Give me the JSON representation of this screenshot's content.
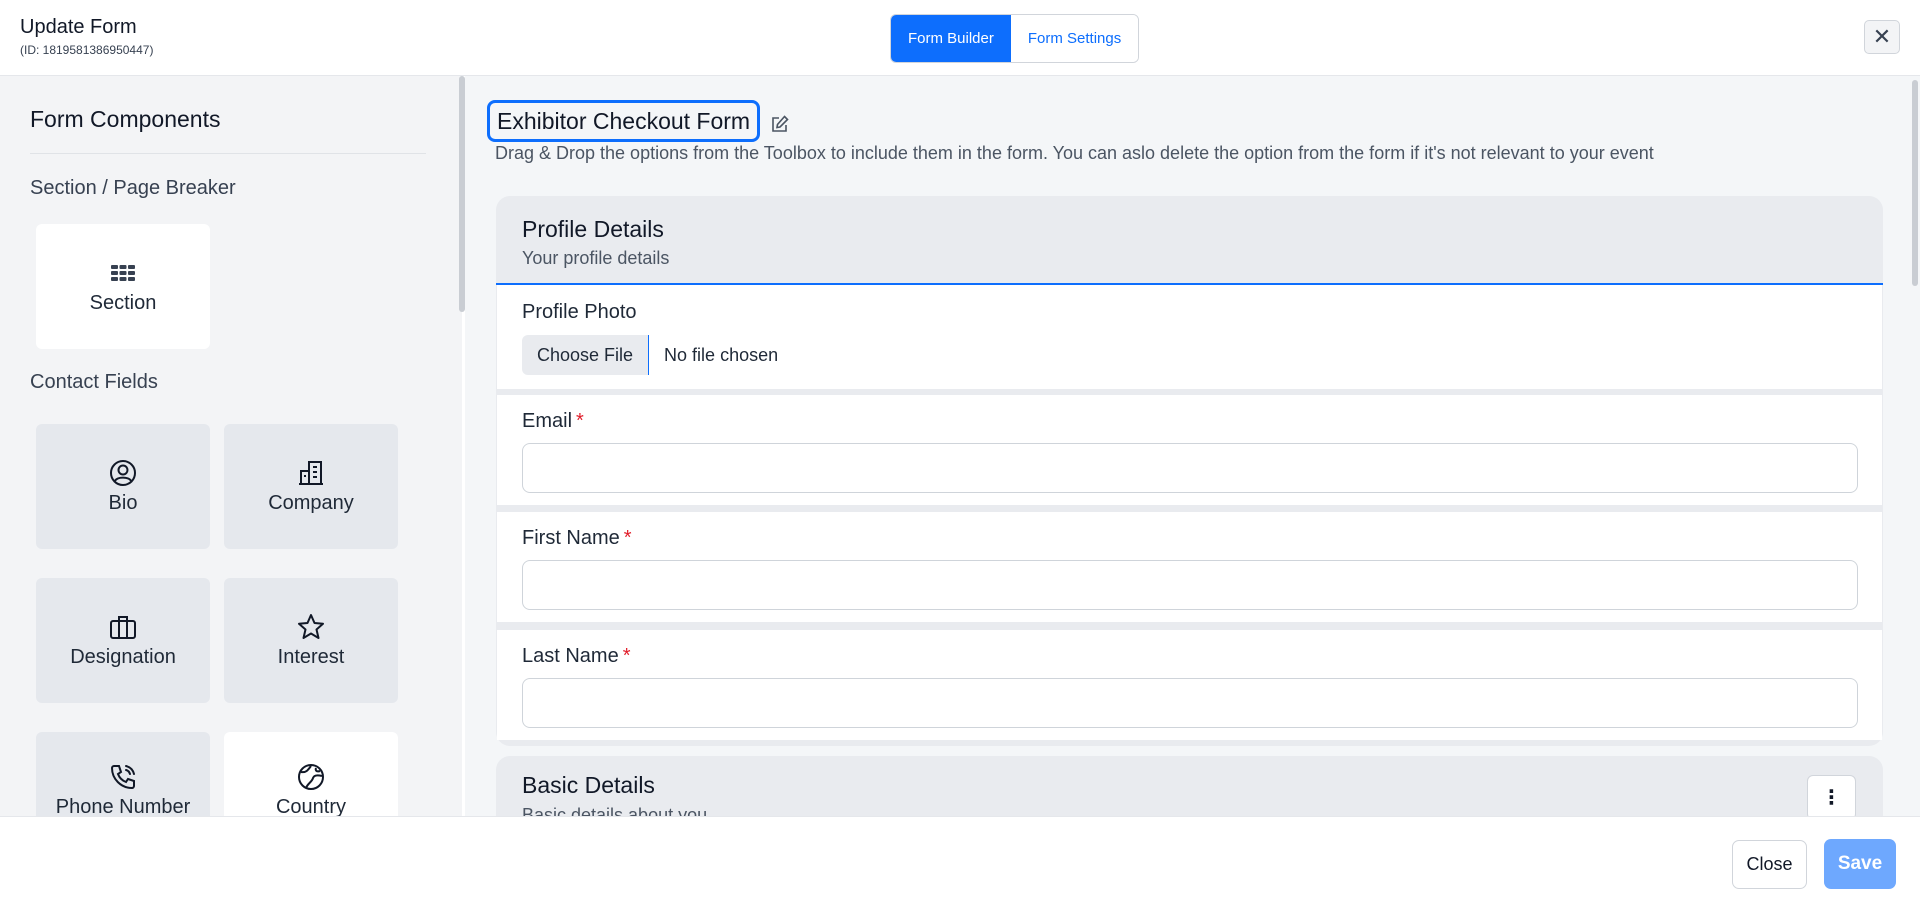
{
  "header": {
    "title": "Update Form",
    "form_id": "(ID: 1819581386950447)",
    "tabs": [
      {
        "label": "Form Builder",
        "active": true
      },
      {
        "label": "Form Settings",
        "active": false
      }
    ],
    "close_symbol": "✕"
  },
  "sidebar": {
    "title": "Form Components",
    "section_group_label": "Section / Page Breaker",
    "contact_group_label": "Contact Fields",
    "components": [
      {
        "label": "Section",
        "icon": "grid-icon"
      },
      {
        "label": "Bio",
        "icon": "user-circle-icon"
      },
      {
        "label": "Company",
        "icon": "building-icon"
      },
      {
        "label": "Designation",
        "icon": "briefcase-icon"
      },
      {
        "label": "Interest",
        "icon": "star-icon"
      },
      {
        "label": "Phone Number",
        "icon": "phone-icon"
      },
      {
        "label": "Country",
        "icon": "globe-icon"
      }
    ]
  },
  "main": {
    "form_title": "Exhibitor Checkout Form",
    "description": "Drag & Drop the options from the Toolbox to include them in the form. You can aslo delete the option from the form if it's not relevant to your event",
    "sections": [
      {
        "title": "Profile Details",
        "subtitle": "Your profile details",
        "fields": [
          {
            "label": "Profile Photo",
            "type": "file",
            "button_label": "Choose File",
            "status": "No file chosen",
            "required": false
          },
          {
            "label": "Email",
            "type": "text",
            "required": true,
            "value": ""
          },
          {
            "label": "First Name",
            "type": "text",
            "required": true,
            "value": ""
          },
          {
            "label": "Last Name",
            "type": "text",
            "required": true,
            "value": ""
          }
        ]
      },
      {
        "title": "Basic Details",
        "subtitle": "Basic details about you",
        "menu_symbol": "⋮"
      }
    ],
    "required_marker": "*"
  },
  "footer": {
    "close_label": "Close",
    "save_label": "Save"
  },
  "colors": {
    "accent": "#0d6efd",
    "save_disabled": "#6ea8fe",
    "required": "#e11d2a"
  }
}
